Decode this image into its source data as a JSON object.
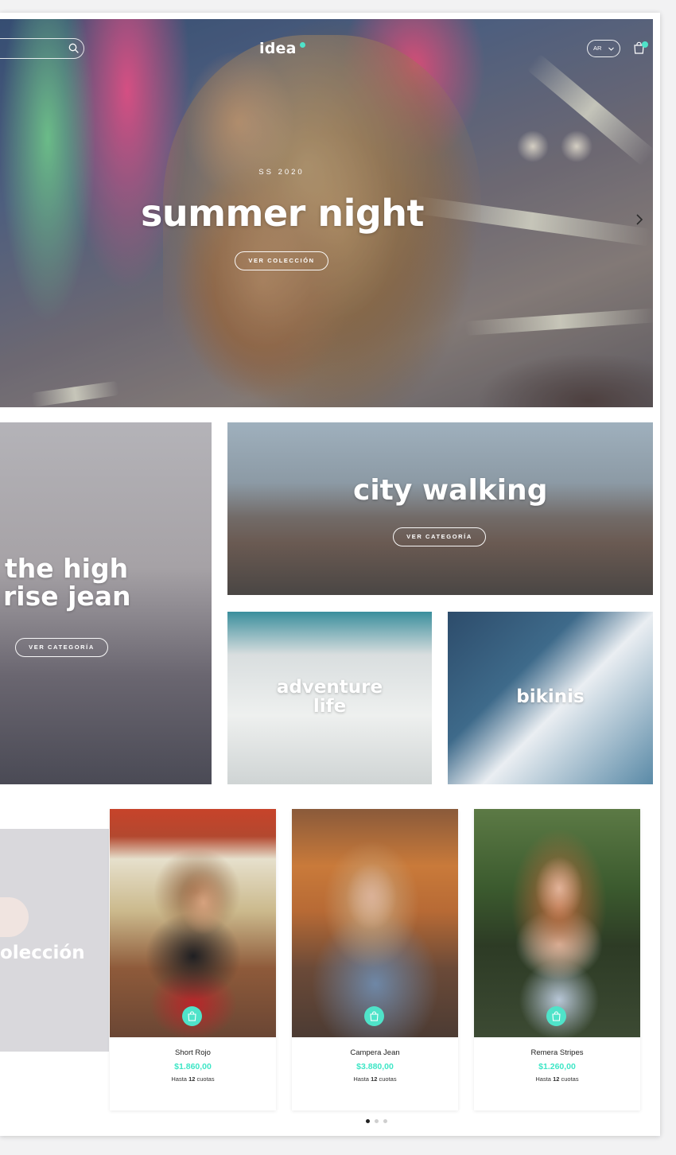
{
  "header": {
    "logo": "idea",
    "language": "AR",
    "icons": {
      "search": "search-icon",
      "language_chevron": "chevron-down-icon",
      "cart": "shopping-bag-icon"
    }
  },
  "hero": {
    "season": "SS 2020",
    "title": "summer night",
    "button": "VER COLECCIÓN",
    "slide_count": 1,
    "active_slide": 1
  },
  "categories": [
    {
      "title_line1": "the high",
      "title_line2": "rise jean",
      "button": "VER CATEGORÍA"
    },
    {
      "title": "city walking",
      "button": "VER CATEGORÍA"
    },
    {
      "title_line1": "adventure",
      "title_line2": "life"
    },
    {
      "title": "bikinis"
    }
  ],
  "collection_tile": {
    "text": "olección"
  },
  "products": [
    {
      "name": "Short Rojo",
      "price": "$1.860,00",
      "installments_prefix": "Hasta",
      "installments_count": "12",
      "installments_suffix": "cuotas"
    },
    {
      "name": "Campera Jean",
      "price": "$3.880,00",
      "installments_prefix": "Hasta",
      "installments_count": "12",
      "installments_suffix": "cuotas"
    },
    {
      "name": "Remera Stripes",
      "price": "$1.260,00",
      "installments_prefix": "Hasta",
      "installments_count": "12",
      "installments_suffix": "cuotas"
    }
  ],
  "carousel": {
    "page_count": 3,
    "active_page": 1
  },
  "colors": {
    "accent": "#4fe3c9",
    "price": "#3ee6c6",
    "dot_active": "#222222",
    "dot_inactive": "#cccccc"
  }
}
